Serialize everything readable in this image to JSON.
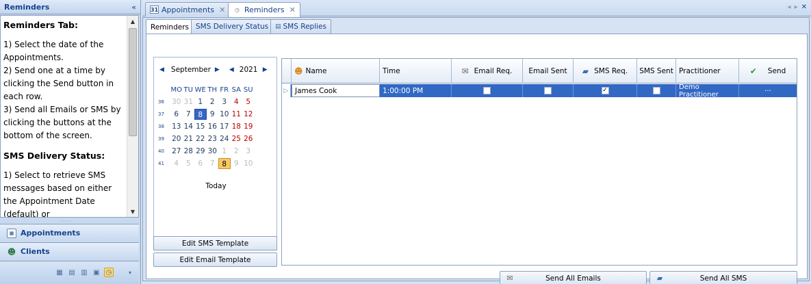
{
  "left_panel": {
    "title": "Reminders",
    "collapse_glyph": "«",
    "help": {
      "heading1": "Reminders Tab:",
      "step1": "1)  Select the date of the Appointments.",
      "step2": "2)  Send one at a time by clicking the Send button in each row.",
      "step3": "3)  Send all Emails or SMS by clicking the buttons at the bottom of the screen.",
      "heading2": "SMS Delivery Status:",
      "step4": "1) Select to retrieve SMS messages based on either the Appointment Date (default) or"
    },
    "nav": {
      "appointments": "Appointments",
      "clients": "Clients"
    },
    "footer_icons": [
      "calendar-icon",
      "page-icon",
      "document-icon",
      "schedule-icon",
      "reminder-icon",
      "overflow-icon"
    ]
  },
  "doc_tabs": [
    {
      "label": "Appointments",
      "icon": "calendar-icon",
      "icon_text": "31"
    },
    {
      "label": "Reminders",
      "icon": "alarm-icon"
    }
  ],
  "sub_tabs": [
    "Reminders",
    "SMS Delivery Status",
    "SMS Replies"
  ],
  "calendar": {
    "month": "September",
    "year": "2021",
    "weekday_headers": [
      "MO",
      "TU",
      "WE",
      "TH",
      "FR",
      "SA",
      "SU"
    ],
    "weeks": [
      {
        "wk": "36",
        "days": [
          "30",
          "31",
          "1",
          "2",
          "3",
          "4",
          "5"
        ]
      },
      {
        "wk": "37",
        "days": [
          "6",
          "7",
          "8",
          "9",
          "10",
          "11",
          "12"
        ]
      },
      {
        "wk": "38",
        "days": [
          "13",
          "14",
          "15",
          "16",
          "17",
          "18",
          "19"
        ]
      },
      {
        "wk": "39",
        "days": [
          "20",
          "21",
          "22",
          "23",
          "24",
          "25",
          "26"
        ]
      },
      {
        "wk": "40",
        "days": [
          "27",
          "28",
          "29",
          "30",
          "1",
          "2",
          "3"
        ]
      },
      {
        "wk": "41",
        "days": [
          "4",
          "5",
          "6",
          "7",
          "8",
          "9",
          "10"
        ]
      }
    ],
    "today_label": "Today"
  },
  "buttons": {
    "edit_sms": "Edit SMS Template",
    "edit_email": "Edit Email Template",
    "send_all_emails": "Send All Emails",
    "send_all_sms": "Send All SMS"
  },
  "grid": {
    "columns": [
      "Name",
      "Time",
      "Email Req.",
      "Email Sent",
      "SMS Req.",
      "SMS Sent",
      "Practitioner",
      "Send"
    ],
    "rows": [
      {
        "name": "James Cook",
        "time": "1:00:00 PM",
        "email_req": false,
        "email_sent": false,
        "sms_req": true,
        "sms_sent": false,
        "practitioner": "Demo Practitioner",
        "send": "···"
      }
    ]
  },
  "colors": {
    "selection": "#3168c4",
    "accent_text": "#15428b",
    "weekend": "#c00000",
    "today": "#f9c864"
  }
}
